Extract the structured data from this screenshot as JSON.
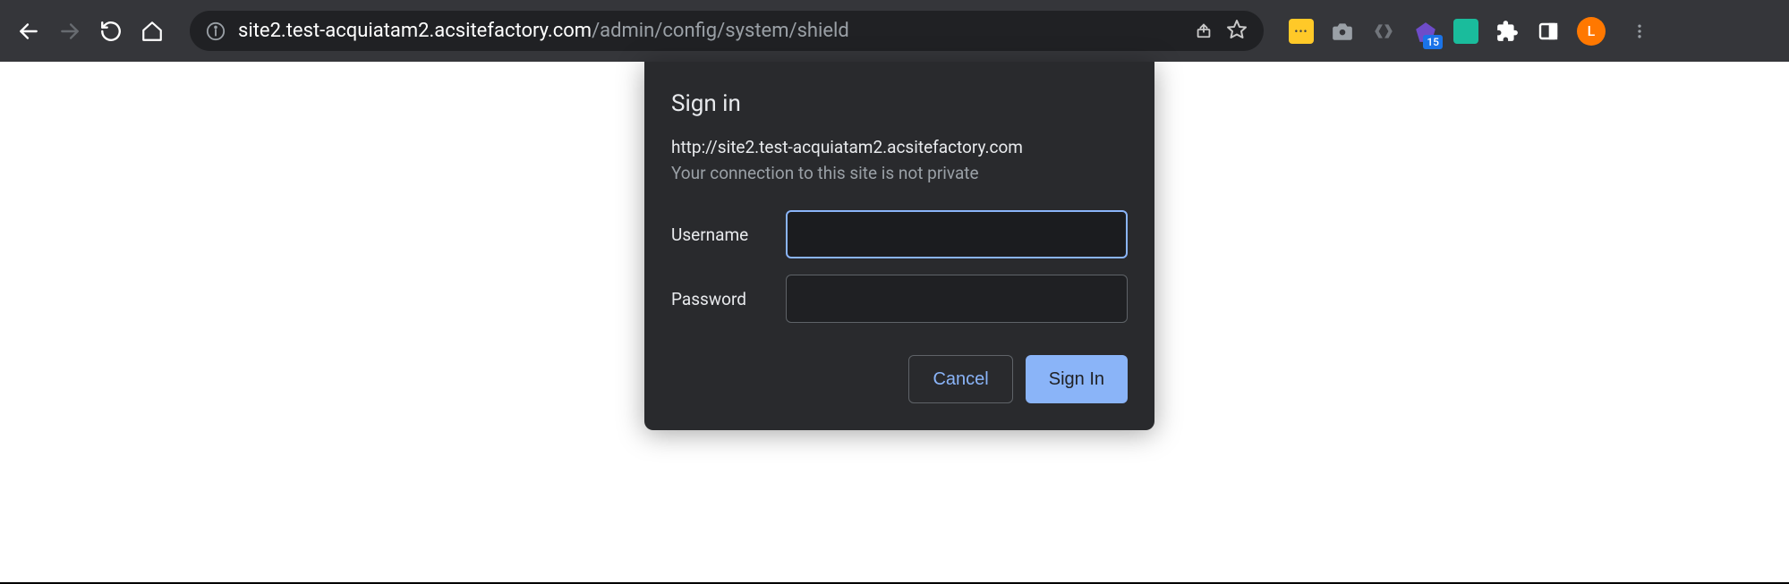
{
  "toolbar": {
    "url_domain": "site2.test-acquiatam2.acsitefactory.com",
    "url_path": "/admin/config/system/shield",
    "badge_count": "15",
    "avatar_letter": "L"
  },
  "dialog": {
    "title": "Sign in",
    "site_url": "http://site2.test-acquiatam2.acsitefactory.com",
    "warning": "Your connection to this site is not private",
    "username_label": "Username",
    "password_label": "Password",
    "username_value": "",
    "password_value": "",
    "cancel_label": "Cancel",
    "signin_label": "Sign In"
  }
}
